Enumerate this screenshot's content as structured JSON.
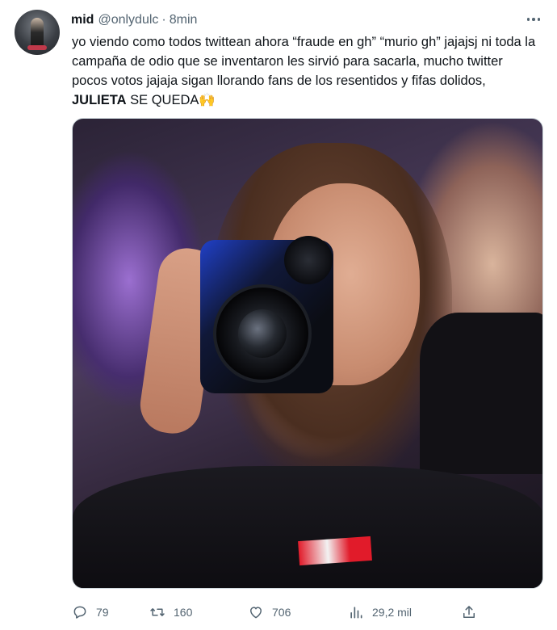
{
  "tweet": {
    "display_name": "mid",
    "handle": "@onlydulc",
    "separator": "·",
    "time": "8min",
    "text_part1": "yo viendo como todos twittean ahora “fraude en gh” “murio gh” jajajsj ni toda la campaña de odio que se inventaron les sirvió para sacarla, mucho twitter pocos votos jajaja sigan llorando fans de los resentidos y fifas dolidos, ",
    "text_bold": "JULIETA",
    "text_part2": " SE QUEDA🙌",
    "media_alt": "photo"
  },
  "actions": {
    "replies": "79",
    "retweets": "160",
    "likes": "706",
    "views": "29,2 mil"
  },
  "colors": {
    "text": "#0f1419",
    "secondary": "#536471"
  },
  "icons": [
    "reply-icon",
    "retweet-icon",
    "like-icon",
    "views-icon",
    "share-icon",
    "more-icon"
  ]
}
